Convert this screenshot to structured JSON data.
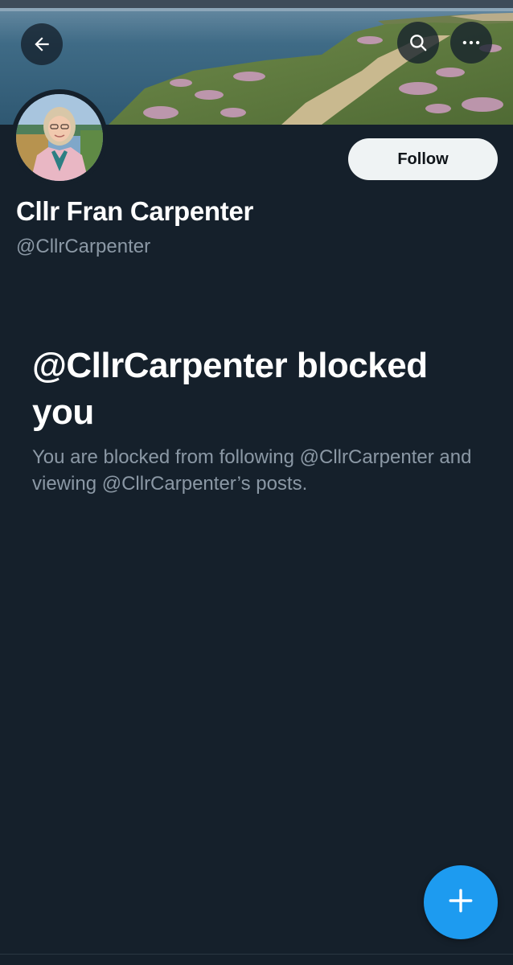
{
  "header": {
    "back_icon": "arrow-left-icon",
    "search_icon": "search-icon",
    "more_icon": "more-horizontal-icon"
  },
  "profile": {
    "display_name": "Cllr Fran Carpenter",
    "handle": "@CllrCarpenter",
    "follow_label": "Follow"
  },
  "blocked": {
    "title": "@CllrCarpenter blocked you",
    "description": "You are blocked from following @CllrCarpenter and viewing @CllrCarpenter’s posts."
  },
  "fab": {
    "icon": "plus-icon"
  },
  "colors": {
    "background": "#15202b",
    "accent": "#1d9bf0",
    "secondary_text": "#8b98a5",
    "follow_button_bg": "#eff3f4"
  }
}
